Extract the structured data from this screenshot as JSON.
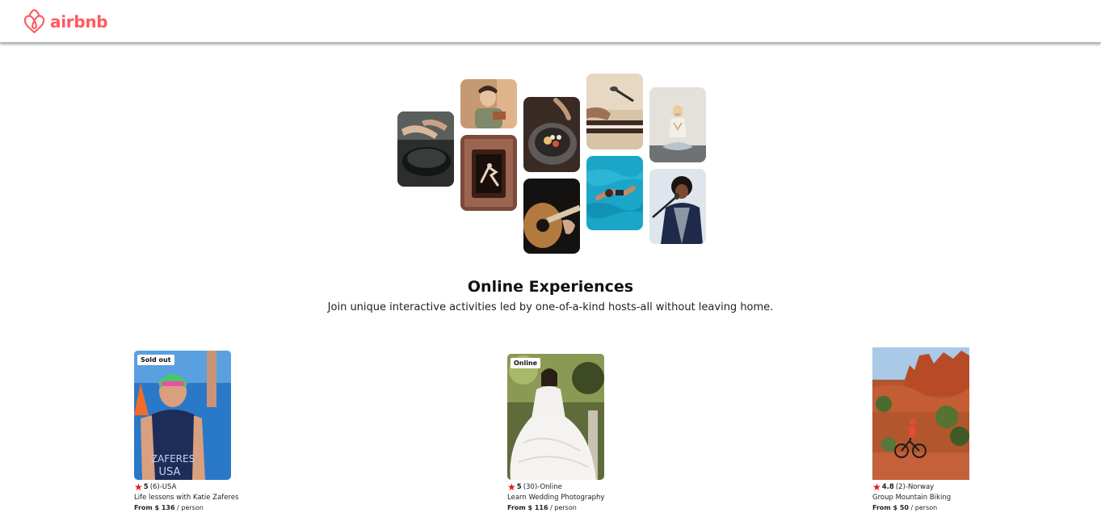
{
  "brand": {
    "name": "airbnb",
    "color": "#ff5a5f",
    "icon": "airbnb-belo-icon"
  },
  "hero": {
    "title": "Online Experiences",
    "subtitle": "Join unique interactive activities led by one-of-a-kind hosts-all without leaving home."
  },
  "cards": [
    {
      "badge": "Sold out",
      "rating": "5",
      "review_count": "(6)",
      "location": "-USA",
      "title": "Life lessons with Katie Zaferes",
      "price_prefix": "From $ 136",
      "price_suffix": " / person"
    },
    {
      "badge": "Online",
      "rating": "5",
      "review_count": "(30)",
      "location": "-Online",
      "title": "Learn Wedding Photography",
      "price_prefix": "From $ 116",
      "price_suffix": " / person"
    },
    {
      "badge": "",
      "rating": "4.8",
      "review_count": "(2)",
      "location": "-Norway",
      "title": "Group Mountain Biking",
      "price_prefix": "From $ 50",
      "price_suffix": " / person"
    }
  ],
  "colors": {
    "star": "#e01919",
    "text": "#222222"
  }
}
